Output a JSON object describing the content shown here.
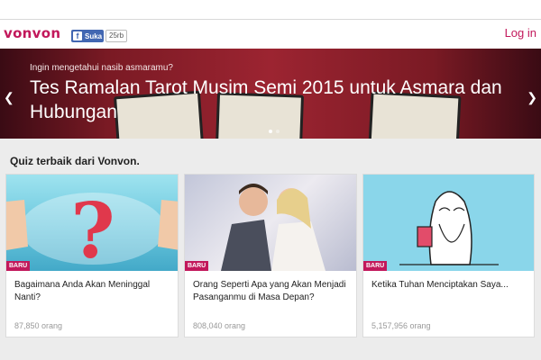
{
  "header": {
    "logo": "vonvon",
    "fb_label": "Suka",
    "fb_count": "25rb",
    "login": "Log in"
  },
  "hero": {
    "subtitle": "Ingin mengetahui nasib asmaramu?",
    "title": "Tes Ramalan Tarot Musim Semi 2015 untuk Asmara dan Hubungan",
    "prev_icon": "chevron-left-icon",
    "next_icon": "chevron-right-icon"
  },
  "section": {
    "title": "Quiz terbaik dari Vonvon."
  },
  "quizzes": [
    {
      "badge": "BARU",
      "title": "Bagaimana Anda Akan Meninggal Nanti?",
      "count": "87,850 orang"
    },
    {
      "badge": "BARU",
      "title": "Orang Seperti Apa yang Akan Menjadi Pasanganmu di Masa Depan?",
      "count": "808,040 orang"
    },
    {
      "badge": "BARU",
      "title": "Ketika Tuhan Menciptakan Saya...",
      "count": "5,157,956 orang"
    }
  ],
  "colors": {
    "accent": "#c2185b",
    "facebook": "#4267b2"
  }
}
